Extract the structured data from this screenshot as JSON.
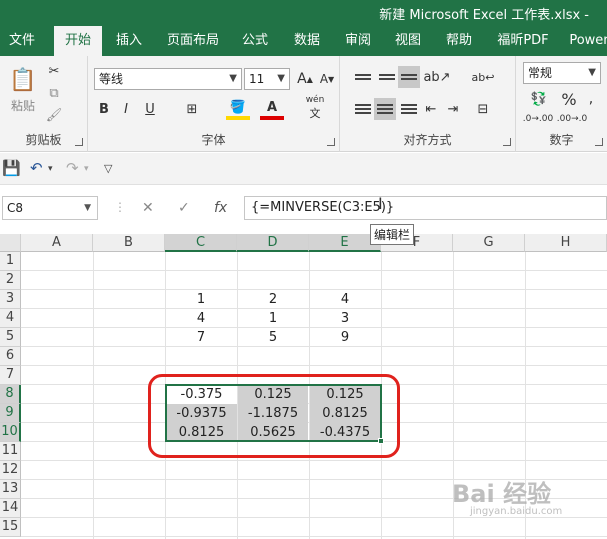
{
  "window": {
    "title": "新建 Microsoft Excel 工作表.xlsx  -"
  },
  "tabs": [
    "文件",
    "开始",
    "插入",
    "页面布局",
    "公式",
    "数据",
    "审阅",
    "视图",
    "帮助",
    "福昕PDF",
    "Power"
  ],
  "ribbon": {
    "clipboard": {
      "paste_label": "粘贴",
      "group_label": "剪贴板"
    },
    "font": {
      "font_name": "等线",
      "font_size": "11",
      "bold": "B",
      "italic": "I",
      "underline": "U",
      "phonetic": "wén",
      "group_label": "字体"
    },
    "alignment": {
      "group_label": "对齐方式"
    },
    "number": {
      "format": "常规",
      "percent": "%",
      "group_label": "数字"
    }
  },
  "formula_bar": {
    "name_box": "C8",
    "fx": "fx",
    "cancel": "✕",
    "enter": "✓",
    "formula": "{=MINVERSE(C3:E5)}",
    "tooltip": "编辑栏"
  },
  "grid": {
    "columns": [
      "A",
      "B",
      "C",
      "D",
      "E",
      "F",
      "G",
      "H"
    ],
    "rows": [
      "1",
      "2",
      "3",
      "4",
      "5",
      "6",
      "7",
      "8",
      "9",
      "10",
      "11",
      "12",
      "13",
      "14",
      "15"
    ],
    "matrix": [
      [
        "1",
        "2",
        "4"
      ],
      [
        "4",
        "1",
        "3"
      ],
      [
        "7",
        "5",
        "9"
      ]
    ],
    "inverse": [
      [
        "-0.375",
        "0.125",
        "0.125"
      ],
      [
        "-0.9375",
        "-1.1875",
        "0.8125"
      ],
      [
        "0.8125",
        "0.5625",
        "-0.4375"
      ]
    ]
  },
  "watermark": {
    "text": "Bai 经验",
    "sub": "jingyan.baidu.com"
  },
  "colors": {
    "brand": "#217346",
    "annotation": "#e0221d"
  }
}
